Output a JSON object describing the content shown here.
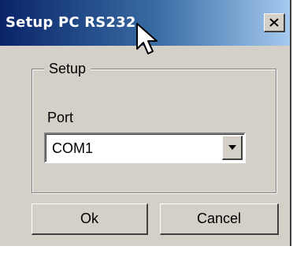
{
  "window": {
    "title": "Setup PC RS232",
    "close_label": "X"
  },
  "setup_group": {
    "label": "Setup",
    "port_label": "Port",
    "port_value": "COM1"
  },
  "buttons": {
    "ok_label": "Ok",
    "cancel_label": "Cancel"
  },
  "icons": {
    "close": "close-icon",
    "dropdown": "chevron-down-icon",
    "cursor": "mouse-pointer-icon"
  },
  "colors": {
    "title_start": "#0a246a",
    "title_end": "#a6caf0",
    "face": "#d4d0c8"
  }
}
